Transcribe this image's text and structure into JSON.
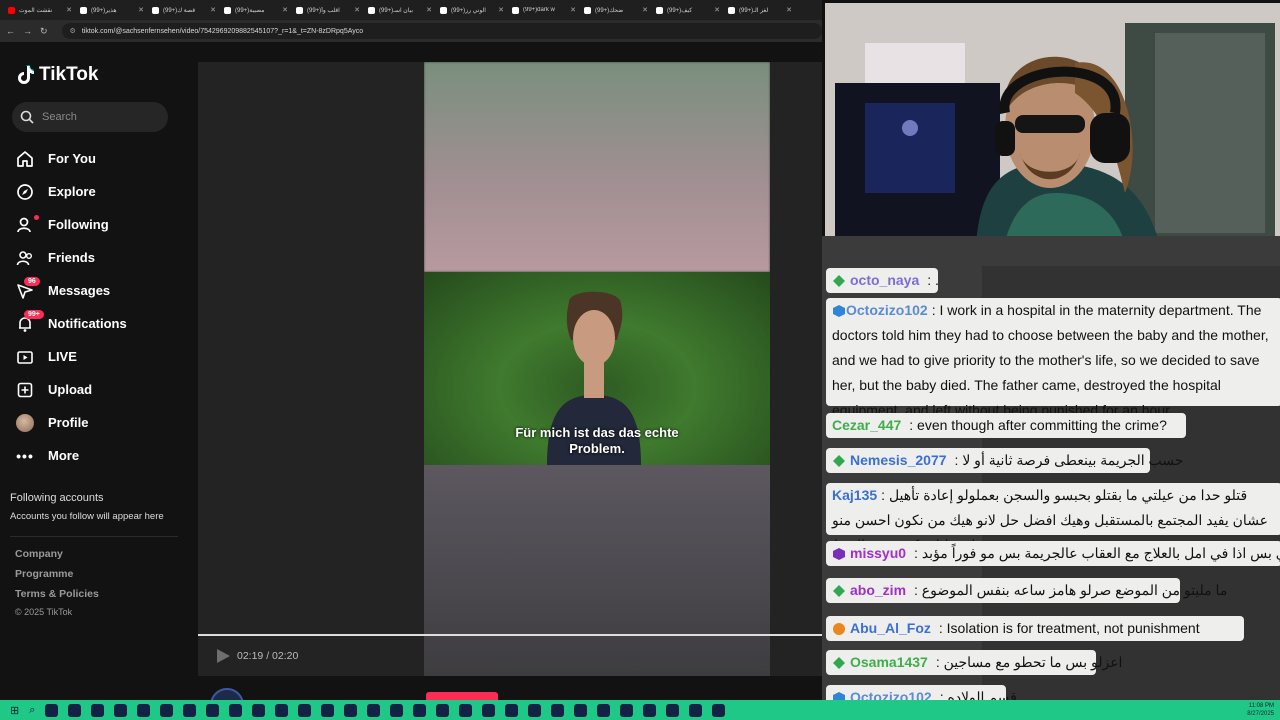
{
  "browser": {
    "tabs": [
      {
        "title": "نقشت الموت",
        "favicon": "youtube"
      },
      {
        "title": "(99+)هذير",
        "favicon": "tiktok"
      },
      {
        "title": "(99+)قصة ك",
        "favicon": "tiktok"
      },
      {
        "title": "(99+)مصيبة",
        "favicon": "tiktok"
      },
      {
        "title": "(99+)اقلب وأ",
        "favicon": "tiktok"
      },
      {
        "title": "(99+)بيان اسـ",
        "favicon": "tiktok"
      },
      {
        "title": "(99+)الوني رز",
        "favicon": "tiktok"
      },
      {
        "title": "(99+)dark w",
        "favicon": "tiktok"
      },
      {
        "title": "(99+)ضحك",
        "favicon": "tiktok"
      },
      {
        "title": "(99+)كيف",
        "favicon": "tiktok"
      },
      {
        "title": "(99+)لغز الـ",
        "favicon": "tiktok"
      }
    ],
    "url": "tiktok.com/@sachsenfernsehen/video/7542969209882545107?_r=1&_t=ZN-8zDRpq5Ayco"
  },
  "sidebar": {
    "logo": "TikTok",
    "search_placeholder": "Search",
    "items": [
      {
        "label": "For You",
        "icon": "home-icon"
      },
      {
        "label": "Explore",
        "icon": "compass-icon"
      },
      {
        "label": "Following",
        "icon": "following-icon"
      },
      {
        "label": "Friends",
        "icon": "friends-icon"
      },
      {
        "label": "Messages",
        "icon": "messages-icon",
        "badge": "96"
      },
      {
        "label": "Notifications",
        "icon": "bell-icon",
        "badge": "99+"
      },
      {
        "label": "LIVE",
        "icon": "live-icon"
      },
      {
        "label": "Upload",
        "icon": "upload-icon"
      },
      {
        "label": "Profile",
        "icon": "avatar"
      },
      {
        "label": "More",
        "icon": "more-icon"
      }
    ],
    "following_title": "Following accounts",
    "following_sub": "Accounts you follow will appear here",
    "footer": [
      "Company",
      "Programme",
      "Terms & Policies"
    ],
    "copyright": "© 2025 TikTok"
  },
  "player": {
    "subtitle_line1": "Für mich ist das das echte",
    "subtitle_line2": "Problem.",
    "time": "02:19 / 02:20",
    "progress": 0.993,
    "creator": "sachsenfernsehen"
  },
  "chat": {
    "messages": [
      {
        "user": "octo_naya",
        "text": ": .",
        "color": "#7c6cd8",
        "badge": "green-diamond-icon"
      },
      {
        "user": "Octozizo102",
        "text": ": I work in a hospital in the maternity department. The doctors told him they had to choose between the baby and the mother, and we had to give priority to the mother's life, so we decided to save her, but the baby died. The father came, destroyed the hospital equipment, and left without being punished for an hour",
        "color": "#5a8ad8",
        "badge": "blue-cube-icon"
      },
      {
        "user": "Cezar_447",
        "text": ": even though after committing the crime?",
        "color": "#3fae4a",
        "badge": ""
      },
      {
        "user": "Nemesis_2077",
        "text": ": حسب الجريمة بينعطى فرصة ثانية أو لا",
        "color": "#3b6fd8",
        "badge": "green-diamond-icon"
      },
      {
        "user": "Kaj135",
        "text": ": قتلو حدا من عيلتي ما بقتلو بحبسو والسجن بعملولو إعادة تأهيل عشان يفيد المجتمع بالمستقبل وهيك افضل حل لانو هيك من نكون احسن منو لو قتلنا منكون زيو بالزبط",
        "color": "#3b6fd8",
        "badge": ""
      },
      {
        "user": "missyu0",
        "text": ": عزل ضروري بس اذا في امل بالعلاج مع العقاب عالجريمة بس مو فوراً مؤبد",
        "color": "#a030c8",
        "badge": "purple-gem-icon"
      },
      {
        "user": "abo_zim",
        "text": ": ما مليتو من الموضع صرلو هامز ساعه بنفس الموضوع",
        "color": "#a030c8",
        "badge": "green-diamond-icon"
      },
      {
        "user": "Abu_Al_Foz",
        "text": ": Isolation is for treatment, not punishment",
        "color": "#3b6fd8",
        "badge": "orange-badge-icon"
      },
      {
        "user": "Osama1437",
        "text": ": اعزلو بس ما تحطو مع مساجين",
        "color": "#3fae4a",
        "badge": "green-diamond-icon"
      },
      {
        "user": "Octozizo102",
        "text": ": قسم الولاده",
        "color": "#5a8ad8",
        "badge": "blue-cube-icon"
      }
    ]
  },
  "taskbar": {
    "time": "11:08 PM",
    "date": "8/27/2025"
  }
}
